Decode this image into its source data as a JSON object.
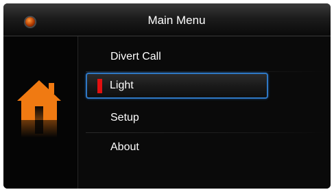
{
  "header": {
    "title": "Main Menu"
  },
  "colors": {
    "accent": "#2f78c4",
    "selector": "#e21010",
    "home_icon": "#f07a12"
  },
  "icons": {
    "status_led": "status-led-icon",
    "home": "home-icon"
  },
  "menu": {
    "selected_index": 1,
    "items": [
      {
        "label": "Divert Call"
      },
      {
        "label": "Light"
      },
      {
        "label": "Setup"
      },
      {
        "label": "About"
      }
    ]
  }
}
